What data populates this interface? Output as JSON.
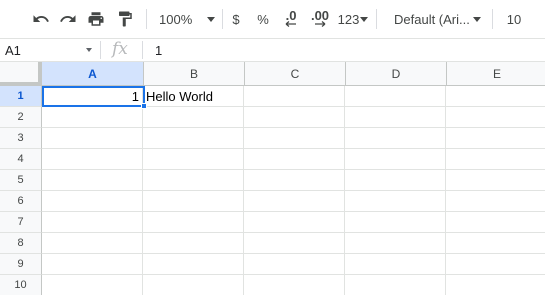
{
  "toolbar": {
    "undo_icon": "undo-icon",
    "redo_icon": "redo-icon",
    "print_icon": "print-icon",
    "paint_format_icon": "paint-format-icon",
    "zoom": "100%",
    "currency": "$",
    "percent": "%",
    "decrease_decimal": ".0",
    "increase_decimal": ".00",
    "more_formats": "123",
    "font": "Default (Ari...",
    "font_size": "10"
  },
  "formula_bar": {
    "name_box": "A1",
    "fx_label": "fx",
    "value": "1"
  },
  "grid": {
    "columns": [
      "A",
      "B",
      "C",
      "D",
      "E"
    ],
    "rows": [
      "1",
      "2",
      "3",
      "4",
      "5",
      "6",
      "7",
      "8",
      "9",
      "10"
    ],
    "selected_cell": "A1",
    "cells": {
      "A1": "1",
      "B1": "Hello World"
    }
  },
  "colors": {
    "accent": "#1a73e8",
    "header_selected_bg": "#d3e3fd",
    "header_selected_text": "#0b57d0"
  }
}
